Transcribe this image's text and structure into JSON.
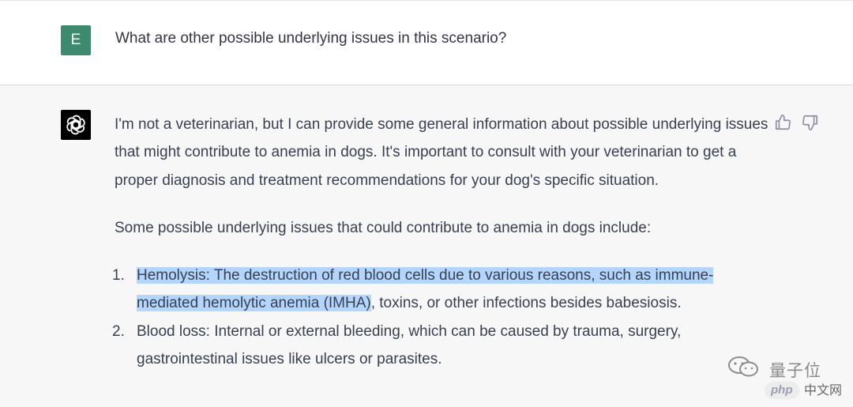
{
  "user": {
    "avatar_letter": "E",
    "message": "What are other possible underlying issues in this scenario?"
  },
  "assistant": {
    "para1": "I'm not a veterinarian, but I can provide some general information about possible underlying issues that might contribute to anemia in dogs. It's important to consult with your veterinarian to get a proper diagnosis and treatment recommendations for your dog's specific situation.",
    "para2": "Some possible underlying issues that could contribute to anemia in dogs include:",
    "list": [
      {
        "num": "1.",
        "highlighted": "Hemolysis: The destruction of red blood cells due to various reasons, such as immune-mediated hemolytic anemia (IMHA)",
        "rest": ", toxins, or other infections besides babesiosis."
      },
      {
        "num": "2.",
        "text": "Blood loss: Internal or external bleeding, which can be caused by trauma, surgery, gastrointestinal issues like ulcers or parasites."
      }
    ],
    "feedback": {
      "up_icon": "thumbs-up-icon",
      "down_icon": "thumbs-down-icon"
    }
  },
  "watermark": {
    "name": "量子位",
    "badge": "php",
    "site": "中文网"
  },
  "colors": {
    "user_avatar": "#3d8a6f",
    "assistant_bg": "#f7f7f8",
    "highlight": "#b4d5fe"
  }
}
